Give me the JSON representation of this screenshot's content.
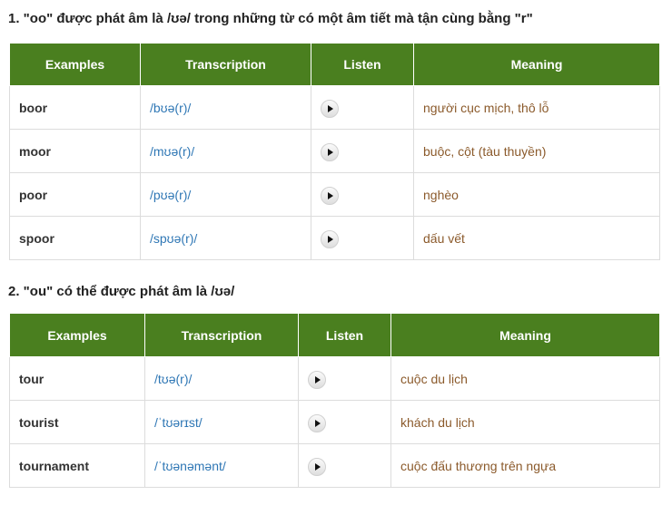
{
  "section1": {
    "heading": "1. \"oo\" được phát âm là /ʊə/ trong những từ có một âm tiết mà tận cùng bằng \"r\"",
    "headers": {
      "examples": "Examples",
      "transcription": "Transcription",
      "listen": "Listen",
      "meaning": "Meaning"
    },
    "rows": [
      {
        "word": "boor",
        "ipa": "/bʊə(r)/",
        "meaning": "người cục mịch, thô lỗ"
      },
      {
        "word": "moor",
        "ipa": "/mʊə(r)/",
        "meaning": "buộc, cột (tàu thuyền)"
      },
      {
        "word": "poor",
        "ipa": "/pʊə(r)/",
        "meaning": "nghèo"
      },
      {
        "word": "spoor",
        "ipa": "/spʊə(r)/",
        "meaning": "dấu vết"
      }
    ]
  },
  "section2": {
    "heading": "2. \"ou\" có thể được phát âm là /ʊə/",
    "headers": {
      "examples": "Examples",
      "transcription": "Transcription",
      "listen": "Listen",
      "meaning": "Meaning"
    },
    "rows": [
      {
        "word": "tour",
        "ipa": "/tʊə(r)/",
        "meaning": "cuộc du lịch"
      },
      {
        "word": "tourist",
        "ipa": "/ˈtʊərɪst/",
        "meaning": "khách du lịch"
      },
      {
        "word": "tournament",
        "ipa": "/ˈtʊənəmənt/",
        "meaning": "cuộc đấu thương trên ngựa"
      }
    ]
  },
  "colors": {
    "header_bg": "#4a7f1f",
    "ipa": "#2f77b5",
    "meaning": "#8b5a2b"
  },
  "icons": {
    "listen": "play-icon"
  }
}
